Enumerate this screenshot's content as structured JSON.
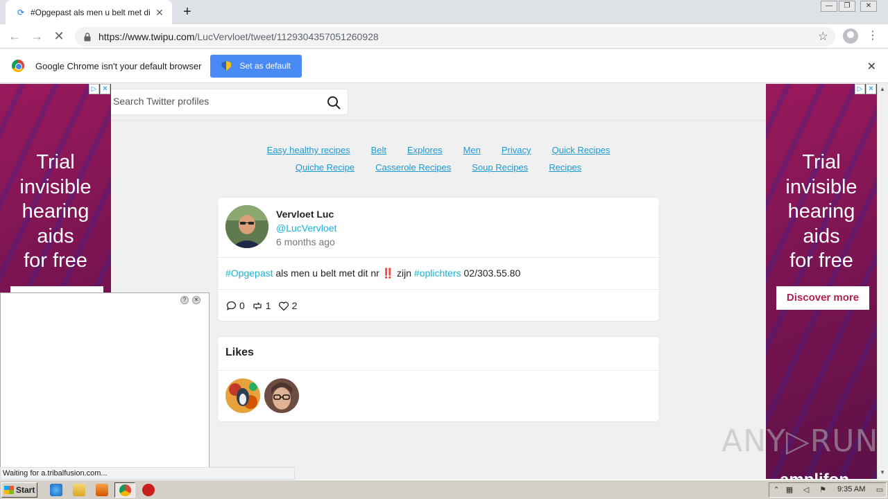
{
  "browser": {
    "tab_title": "#Opgepast als men u belt met dit nr",
    "tab_close": "✕",
    "new_tab": "+",
    "url_host": "https://www.twipu.com",
    "url_path": "/LucVervloet/tweet/1129304357051260928",
    "window_controls": [
      "—",
      "❐",
      "✕"
    ]
  },
  "infobar": {
    "message": "Google Chrome isn't your default browser",
    "button_label": "Set as default",
    "close": "✕"
  },
  "search": {
    "placeholder": "Search Twitter profiles"
  },
  "links": {
    "row1": [
      "Easy healthy recipes",
      "Belt",
      "Explores",
      "Men",
      "Privacy",
      "Quick Recipes"
    ],
    "row2": [
      "Quiche Recipe",
      "Casserole Recipes",
      "Soup Recipes",
      "Recipes"
    ]
  },
  "tweet": {
    "name": "Vervloet Luc",
    "handle": "@LucVervloet",
    "time": "6 months ago",
    "text_parts": [
      {
        "text": "#Opgepast",
        "tag": true
      },
      {
        "text": " als men u belt met dit nr ‼️ zijn ",
        "tag": false
      },
      {
        "text": "#oplichters",
        "tag": true
      },
      {
        "text": " 02/303.55.80",
        "tag": false
      }
    ],
    "replies": "0",
    "retweets": "1",
    "likes": "2"
  },
  "likes_card": {
    "title": "Likes",
    "count": 2
  },
  "ads": {
    "left_text": [
      "Trial",
      "invisible",
      "hearing",
      "aids",
      "for free"
    ],
    "right_text": [
      "Trial",
      "invisible",
      "hearing",
      "aids",
      "for free"
    ],
    "right_button": "Discover more",
    "right_bottom_word": "amplifon"
  },
  "status": {
    "text": "Waiting for a.tribalfusion.com..."
  },
  "watermark": "ANY▷RUN",
  "taskbar": {
    "start_label": "Start",
    "clock": "9:35 AM"
  },
  "colors": {
    "link": "#1a9ad6",
    "hashtag": "#1ab2d8",
    "ad_bg": "#7b1452",
    "set_default_btn": "#4a8af4"
  }
}
